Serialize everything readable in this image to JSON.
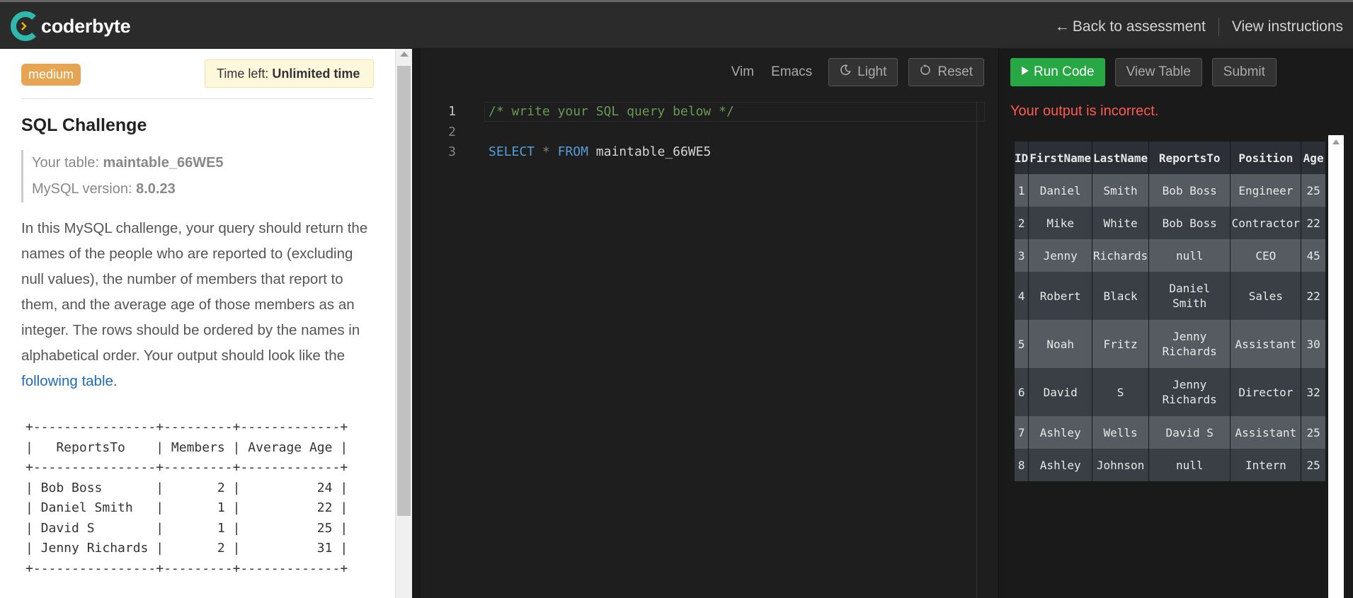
{
  "header": {
    "brand": "coderbyte",
    "back_label": "Back to assessment",
    "instructions_label": "View instructions"
  },
  "problem": {
    "difficulty": "medium",
    "time_left_label": "Time left:",
    "time_left_value": "Unlimited time",
    "title": "SQL Challenge",
    "table_label": "Your table:",
    "table_name": "maintable_66WE5",
    "version_label": "MySQL version:",
    "version_value": "8.0.23",
    "description": "In this MySQL challenge, your query should return the names of the people who are reported to (excluding null values), the number of members that report to them, and the average age of those members as an integer. The rows should be ordered by the names in alphabetical order. Your output should look like the",
    "link_text": "following table",
    "description_end": ".",
    "expected_output": "+----------------+---------+-------------+\n|   ReportsTo    | Members | Average Age |\n+----------------+---------+-------------+\n| Bob Boss       |       2 |          24 |\n| Daniel Smith   |       1 |          22 |\n| David S        |       1 |          25 |\n| Jenny Richards |       2 |          31 |\n+----------------+---------+-------------+"
  },
  "editor": {
    "vim_label": "Vim",
    "emacs_label": "Emacs",
    "light_label": "Light",
    "reset_label": "Reset",
    "line_numbers": [
      "1",
      "2",
      "3"
    ],
    "code_comment": "/* write your SQL query below */",
    "code_select": "SELECT",
    "code_star": "*",
    "code_from": "FROM",
    "code_table": "maintable_66WE5"
  },
  "output": {
    "run_label": "Run Code",
    "view_table_label": "View Table",
    "submit_label": "Submit",
    "status": "Your output is incorrect.",
    "columns": [
      "ID",
      "FirstName",
      "LastName",
      "ReportsTo",
      "Position",
      "Age"
    ],
    "rows": [
      [
        "1",
        "Daniel",
        "Smith",
        "Bob Boss",
        "Engineer",
        "25"
      ],
      [
        "2",
        "Mike",
        "White",
        "Bob Boss",
        "Contractor",
        "22"
      ],
      [
        "3",
        "Jenny",
        "Richards",
        "null",
        "CEO",
        "45"
      ],
      [
        "4",
        "Robert",
        "Black",
        "Daniel Smith",
        "Sales",
        "22"
      ],
      [
        "5",
        "Noah",
        "Fritz",
        "Jenny Richards",
        "Assistant",
        "30"
      ],
      [
        "6",
        "David",
        "S",
        "Jenny Richards",
        "Director",
        "32"
      ],
      [
        "7",
        "Ashley",
        "Wells",
        "David S",
        "Assistant",
        "25"
      ],
      [
        "8",
        "Ashley",
        "Johnson",
        "null",
        "Intern",
        "25"
      ]
    ]
  },
  "colors": {
    "accent_green": "#28a745",
    "error_red": "#ff5a4f",
    "badge_orange": "#e6a552",
    "link_blue": "#1e6bb8"
  }
}
